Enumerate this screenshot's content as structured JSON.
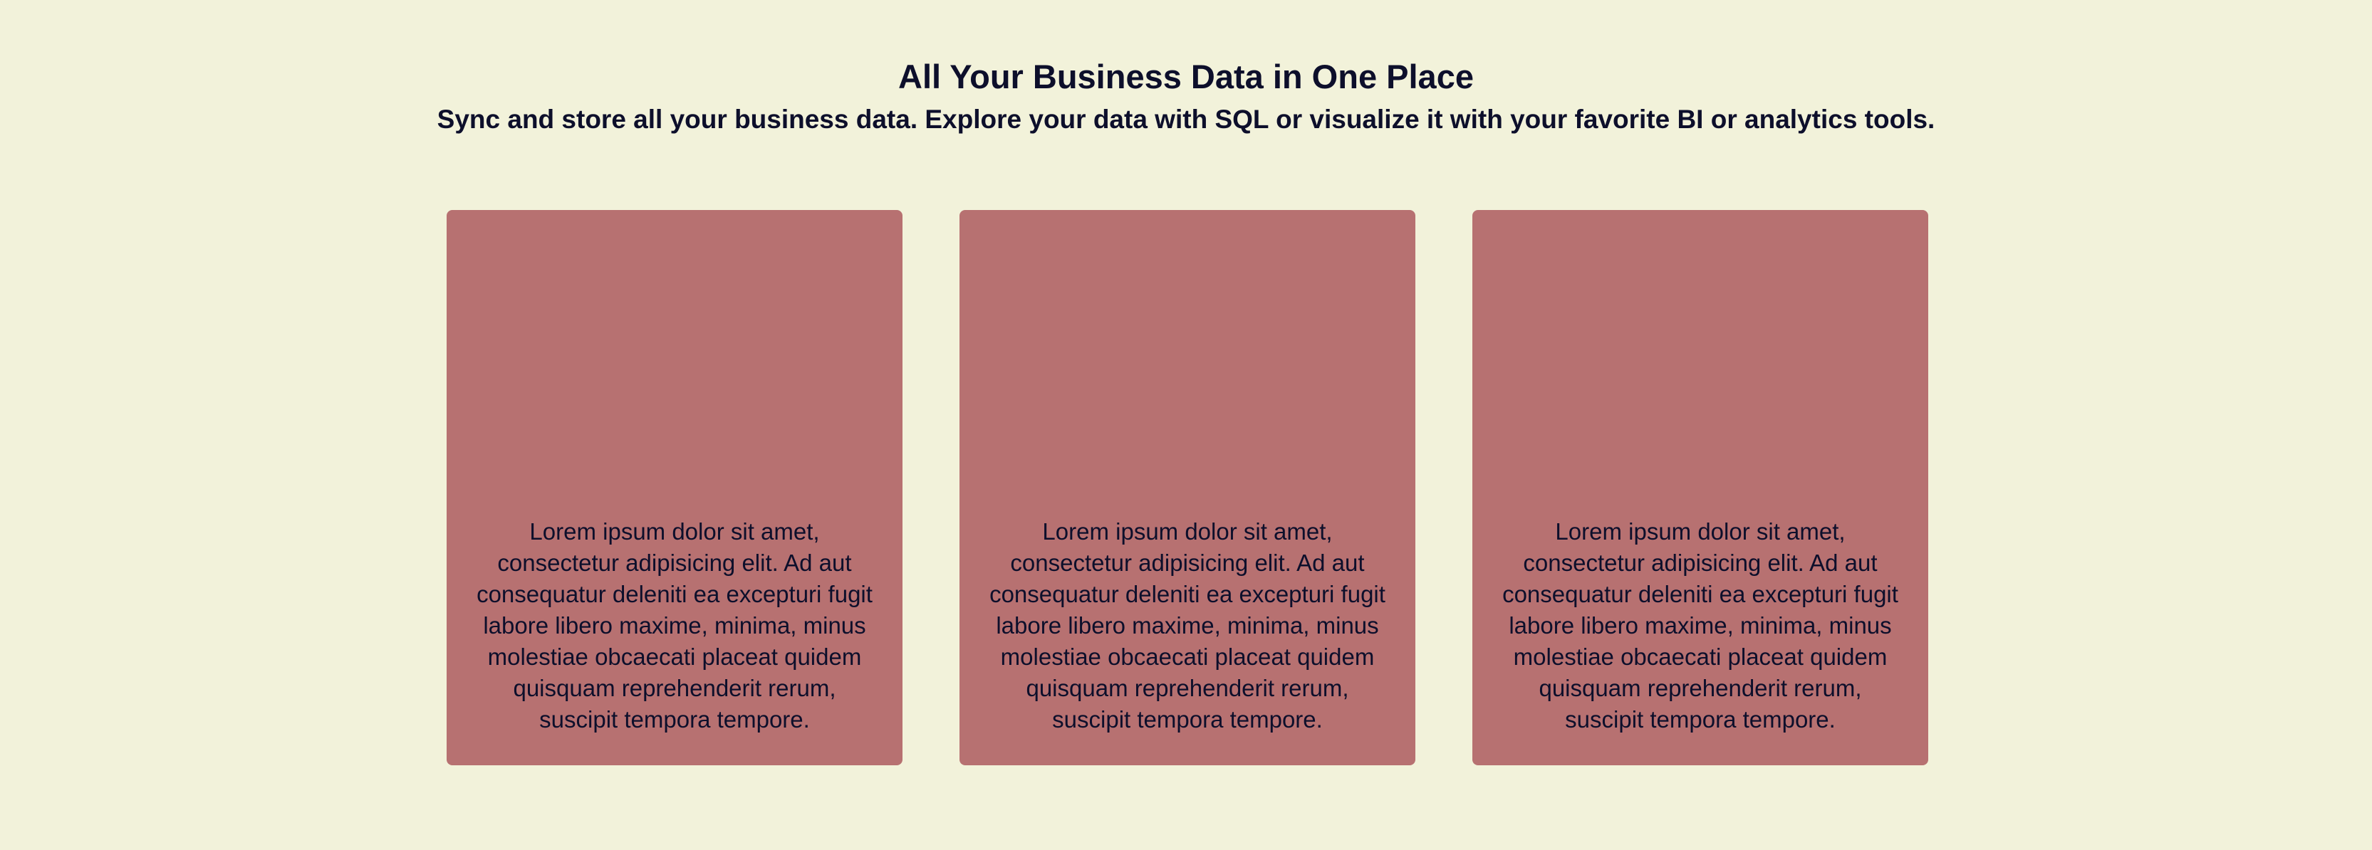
{
  "header": {
    "title": "All Your Business Data in One Place",
    "subtitle": "Sync and store all your business data. Explore your data with SQL or visualize it with your favorite BI or analytics tools."
  },
  "cards": [
    {
      "text": "Lorem ipsum dolor sit amet, consectetur adipisicing elit. Ad aut consequatur deleniti ea excepturi fugit labore libero maxime, minima, minus molestiae obcaecati placeat quidem quisquam reprehenderit rerum, suscipit tempora tempore."
    },
    {
      "text": "Lorem ipsum dolor sit amet, consectetur adipisicing elit. Ad aut consequatur deleniti ea excepturi fugit labore libero maxime, minima, minus molestiae obcaecati placeat quidem quisquam reprehenderit rerum, suscipit tempora tempore."
    },
    {
      "text": "Lorem ipsum dolor sit amet, consectetur adipisicing elit. Ad aut consequatur deleniti ea excepturi fugit labore libero maxime, minima, minus molestiae obcaecati placeat quidem quisquam reprehenderit rerum, suscipit tempora tempore."
    }
  ],
  "colors": {
    "background": "#f2f2da",
    "card": "#b77171",
    "text": "#0d0f2b"
  }
}
